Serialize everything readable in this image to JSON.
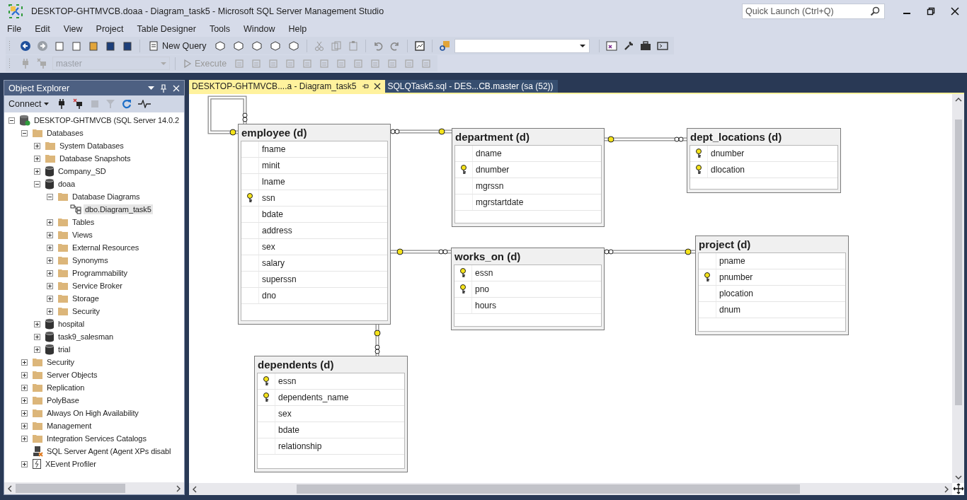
{
  "window": {
    "title": "DESKTOP-GHTMVCB.doaa - Diagram_task5 - Microsoft SQL Server Management Studio"
  },
  "quick_launch": {
    "placeholder": "Quick Launch (Ctrl+Q)"
  },
  "menu": [
    "File",
    "Edit",
    "View",
    "Project",
    "Table Designer",
    "Tools",
    "Window",
    "Help"
  ],
  "toolbar": {
    "new_query": "New Query",
    "database": {
      "value": "master",
      "disabled": true
    },
    "execute": {
      "label": "Execute",
      "disabled": true
    }
  },
  "object_explorer": {
    "title": "Object Explorer",
    "connect": "Connect",
    "tree": [
      {
        "label": "DESKTOP-GHTMVCB (SQL Server 14.0.2",
        "kind": "server",
        "expanded": true,
        "selected": false,
        "children": [
          {
            "label": "Databases",
            "kind": "folder",
            "expanded": true,
            "selected": false,
            "children": [
              {
                "label": "System Databases",
                "kind": "folder",
                "expanded": false,
                "selected": false
              },
              {
                "label": "Database Snapshots",
                "kind": "folder",
                "expanded": false,
                "selected": false
              },
              {
                "label": "Company_SD",
                "kind": "database",
                "expanded": false,
                "selected": false
              },
              {
                "label": "doaa",
                "kind": "database",
                "expanded": true,
                "selected": false,
                "children": [
                  {
                    "label": "Database Diagrams",
                    "kind": "folder",
                    "expanded": true,
                    "selected": false,
                    "children": [
                      {
                        "label": "dbo.Diagram_task5",
                        "kind": "diagram",
                        "selected": true
                      }
                    ]
                  },
                  {
                    "label": "Tables",
                    "kind": "folder",
                    "expanded": false,
                    "selected": false
                  },
                  {
                    "label": "Views",
                    "kind": "folder",
                    "expanded": false,
                    "selected": false
                  },
                  {
                    "label": "External Resources",
                    "kind": "folder",
                    "expanded": false,
                    "selected": false
                  },
                  {
                    "label": "Synonyms",
                    "kind": "folder",
                    "expanded": false,
                    "selected": false
                  },
                  {
                    "label": "Programmability",
                    "kind": "folder",
                    "expanded": false,
                    "selected": false
                  },
                  {
                    "label": "Service Broker",
                    "kind": "folder",
                    "expanded": false,
                    "selected": false
                  },
                  {
                    "label": "Storage",
                    "kind": "folder",
                    "expanded": false,
                    "selected": false
                  },
                  {
                    "label": "Security",
                    "kind": "folder",
                    "expanded": false,
                    "selected": false
                  }
                ]
              },
              {
                "label": "hospital",
                "kind": "database",
                "expanded": false,
                "selected": false
              },
              {
                "label": "task9_salesman",
                "kind": "database",
                "expanded": false,
                "selected": false
              },
              {
                "label": "trial",
                "kind": "database",
                "expanded": false,
                "selected": false
              }
            ]
          },
          {
            "label": "Security",
            "kind": "folder",
            "expanded": false,
            "selected": false
          },
          {
            "label": "Server Objects",
            "kind": "folder",
            "expanded": false,
            "selected": false
          },
          {
            "label": "Replication",
            "kind": "folder",
            "expanded": false,
            "selected": false
          },
          {
            "label": "PolyBase",
            "kind": "folder",
            "expanded": false,
            "selected": false
          },
          {
            "label": "Always On High Availability",
            "kind": "folder",
            "expanded": false,
            "selected": false
          },
          {
            "label": "Management",
            "kind": "folder",
            "expanded": false,
            "selected": false
          },
          {
            "label": "Integration Services Catalogs",
            "kind": "folder",
            "expanded": false,
            "selected": false
          },
          {
            "label": "SQL Server Agent (Agent XPs disabl",
            "kind": "agent",
            "selected": false
          },
          {
            "label": "XEvent Profiler",
            "kind": "xevent",
            "expanded": false,
            "selected": false
          }
        ]
      }
    ]
  },
  "document_tabs": [
    {
      "label": "DESKTOP-GHTMVCB....a - Diagram_task5",
      "selected": true
    },
    {
      "label": "SQLQTask5.sql - DES...CB.master (sa (52))",
      "selected": false
    }
  ],
  "diagram": {
    "tables": [
      {
        "name": "employee (d)",
        "columns": [
          {
            "name": "fname",
            "primary_key": false
          },
          {
            "name": "minit",
            "primary_key": false
          },
          {
            "name": "lname",
            "primary_key": false
          },
          {
            "name": "ssn",
            "primary_key": true
          },
          {
            "name": "bdate",
            "primary_key": false
          },
          {
            "name": "address",
            "primary_key": false
          },
          {
            "name": "sex",
            "primary_key": false
          },
          {
            "name": "salary",
            "primary_key": false
          },
          {
            "name": "superssn",
            "primary_key": false
          },
          {
            "name": "dno",
            "primary_key": false
          }
        ]
      },
      {
        "name": "department (d)",
        "columns": [
          {
            "name": "dname",
            "primary_key": false
          },
          {
            "name": "dnumber",
            "primary_key": true
          },
          {
            "name": "mgrssn",
            "primary_key": false
          },
          {
            "name": "mgrstartdate",
            "primary_key": false
          }
        ]
      },
      {
        "name": "dept_locations (d)",
        "columns": [
          {
            "name": "dnumber",
            "primary_key": true
          },
          {
            "name": "dlocation",
            "primary_key": true
          }
        ]
      },
      {
        "name": "works_on (d)",
        "columns": [
          {
            "name": "essn",
            "primary_key": true
          },
          {
            "name": "pno",
            "primary_key": true
          },
          {
            "name": "hours",
            "primary_key": false
          }
        ]
      },
      {
        "name": "project (d)",
        "columns": [
          {
            "name": "pname",
            "primary_key": false
          },
          {
            "name": "pnumber",
            "primary_key": true
          },
          {
            "name": "plocation",
            "primary_key": false
          },
          {
            "name": "dnum",
            "primary_key": false
          }
        ]
      },
      {
        "name": "dependents (d)",
        "columns": [
          {
            "name": "essn",
            "primary_key": true
          },
          {
            "name": "dependents_name",
            "primary_key": true
          },
          {
            "name": "sex",
            "primary_key": false
          },
          {
            "name": "bdate",
            "primary_key": false
          },
          {
            "name": "relationship",
            "primary_key": false
          }
        ]
      }
    ]
  }
}
